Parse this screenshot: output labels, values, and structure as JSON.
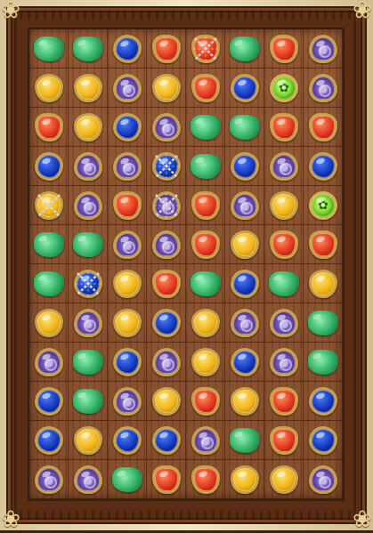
{
  "game": {
    "grid_rows": 12,
    "grid_cols": 8,
    "board": [
      [
        "green",
        "green",
        "blue",
        "red",
        "red",
        "green",
        "red",
        "purple"
      ],
      [
        "yellow",
        "yellow",
        "purple",
        "yellow",
        "red",
        "blue",
        "special",
        "purple"
      ],
      [
        "red",
        "yellow",
        "blue",
        "purple",
        "green",
        "green",
        "red",
        "red"
      ],
      [
        "blue",
        "purple",
        "purple",
        "blue",
        "green",
        "blue",
        "purple",
        "blue"
      ],
      [
        "yellow",
        "purple",
        "red",
        "purple",
        "red",
        "purple",
        "yellow",
        "special"
      ],
      [
        "green",
        "green",
        "purple",
        "purple",
        "red",
        "yellow",
        "red",
        "red"
      ],
      [
        "green",
        "blue",
        "yellow",
        "red",
        "green",
        "blue",
        "green",
        "yellow"
      ],
      [
        "yellow",
        "purple",
        "yellow",
        "blue",
        "yellow",
        "purple",
        "purple",
        "green"
      ],
      [
        "purple",
        "green",
        "blue",
        "purple",
        "yellow",
        "blue",
        "purple",
        "green"
      ],
      [
        "blue",
        "green",
        "purple",
        "yellow",
        "red",
        "yellow",
        "red",
        "blue"
      ],
      [
        "blue",
        "yellow",
        "blue",
        "blue",
        "purple",
        "green",
        "red",
        "blue"
      ],
      [
        "purple",
        "purple",
        "green",
        "red",
        "red",
        "yellow",
        "yellow",
        "purple"
      ]
    ],
    "locked_cells": [
      [
        0,
        4
      ],
      [
        3,
        3
      ],
      [
        4,
        0
      ],
      [
        4,
        3
      ],
      [
        6,
        1
      ]
    ],
    "colors": {
      "frame": "#f0e2bd",
      "board_wood": "#8b4e2a",
      "gem_rim": "#c9a24a"
    }
  }
}
